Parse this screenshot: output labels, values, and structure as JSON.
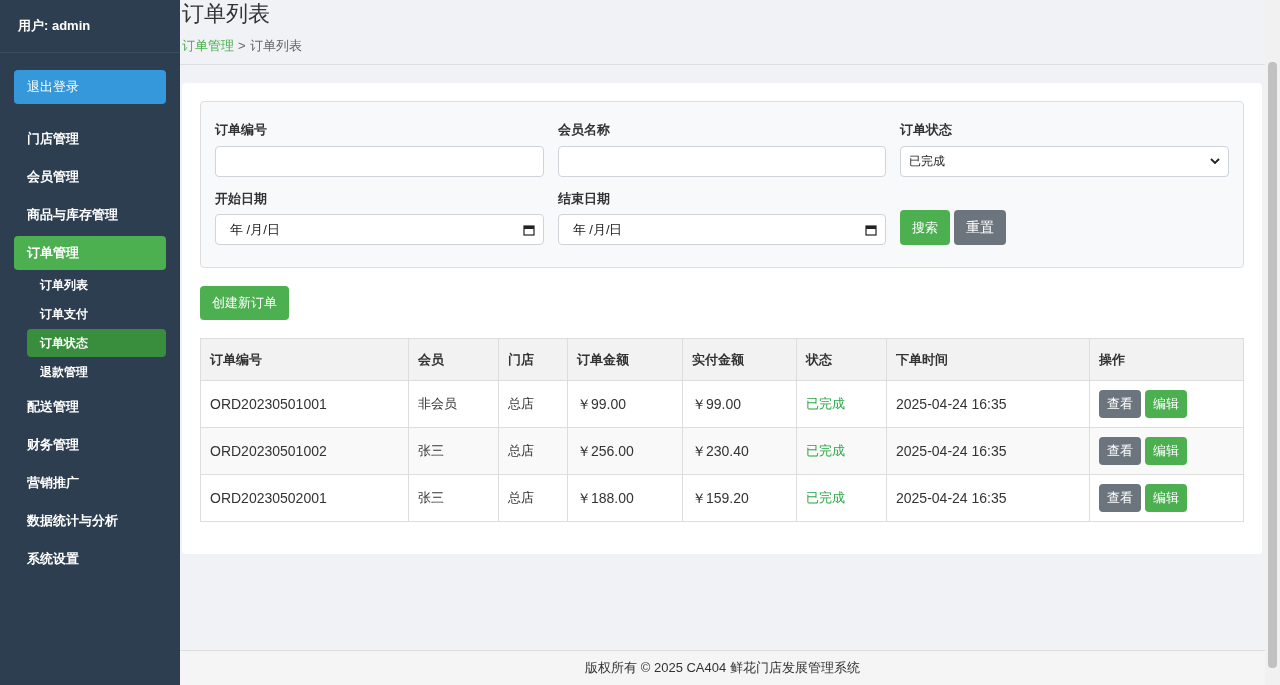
{
  "sidebar": {
    "user": "用户: admin",
    "logout": "退出登录",
    "items": [
      {
        "label": "门店管理",
        "selected": false
      },
      {
        "label": "会员管理",
        "selected": false
      },
      {
        "label": "商品与库存管理",
        "selected": false
      },
      {
        "label": "订单管理",
        "selected": true,
        "children": [
          {
            "label": "订单列表",
            "selected": false
          },
          {
            "label": "订单支付",
            "selected": false
          },
          {
            "label": "订单状态",
            "selected": true
          },
          {
            "label": "退款管理",
            "selected": false
          }
        ]
      },
      {
        "label": "配送管理",
        "selected": false
      },
      {
        "label": "财务管理",
        "selected": false
      },
      {
        "label": "营销推广",
        "selected": false
      },
      {
        "label": "数据统计与分析",
        "selected": false
      },
      {
        "label": "系统设置",
        "selected": false
      }
    ]
  },
  "page": {
    "title": "订单列表",
    "breadcrumb": {
      "parent": "订单管理",
      "separator": ">",
      "current": "订单列表"
    }
  },
  "filters": {
    "fields": [
      {
        "kind": "text",
        "label": "订单编号"
      },
      {
        "kind": "text",
        "label": "会员名称"
      },
      {
        "kind": "select",
        "label": "订单状态",
        "value": "已完成"
      },
      {
        "kind": "date",
        "label": "开始日期",
        "placeholder": "年 /月/日"
      },
      {
        "kind": "date",
        "label": "结束日期",
        "placeholder": "年 /月/日"
      }
    ],
    "search_button": "搜索",
    "reset_button": "重置"
  },
  "create_button": "创建新订单",
  "table": {
    "columns": [
      "订单编号",
      "会员",
      "门店",
      "订单金额",
      "实付金额",
      "状态",
      "下单时间",
      "操作"
    ],
    "rows": [
      {
        "cells": [
          "ORD20230501001",
          "非会员",
          "总店",
          "￥99.00",
          "￥99.00",
          "已完成",
          "2025-04-24 16:35"
        ],
        "actions": [
          "查看",
          "编辑"
        ]
      },
      {
        "cells": [
          "ORD20230501002",
          "张三",
          "总店",
          "￥256.00",
          "￥230.40",
          "已完成",
          "2025-04-24 16:35"
        ],
        "actions": [
          "查看",
          "编辑"
        ]
      },
      {
        "cells": [
          "ORD20230502001",
          "张三",
          "总店",
          "￥188.00",
          "￥159.20",
          "已完成",
          "2025-04-24 16:35"
        ],
        "actions": [
          "查看",
          "编辑"
        ]
      }
    ]
  },
  "footer": "版权所有 © 2025 CA404 鲜花门店发展管理系统"
}
